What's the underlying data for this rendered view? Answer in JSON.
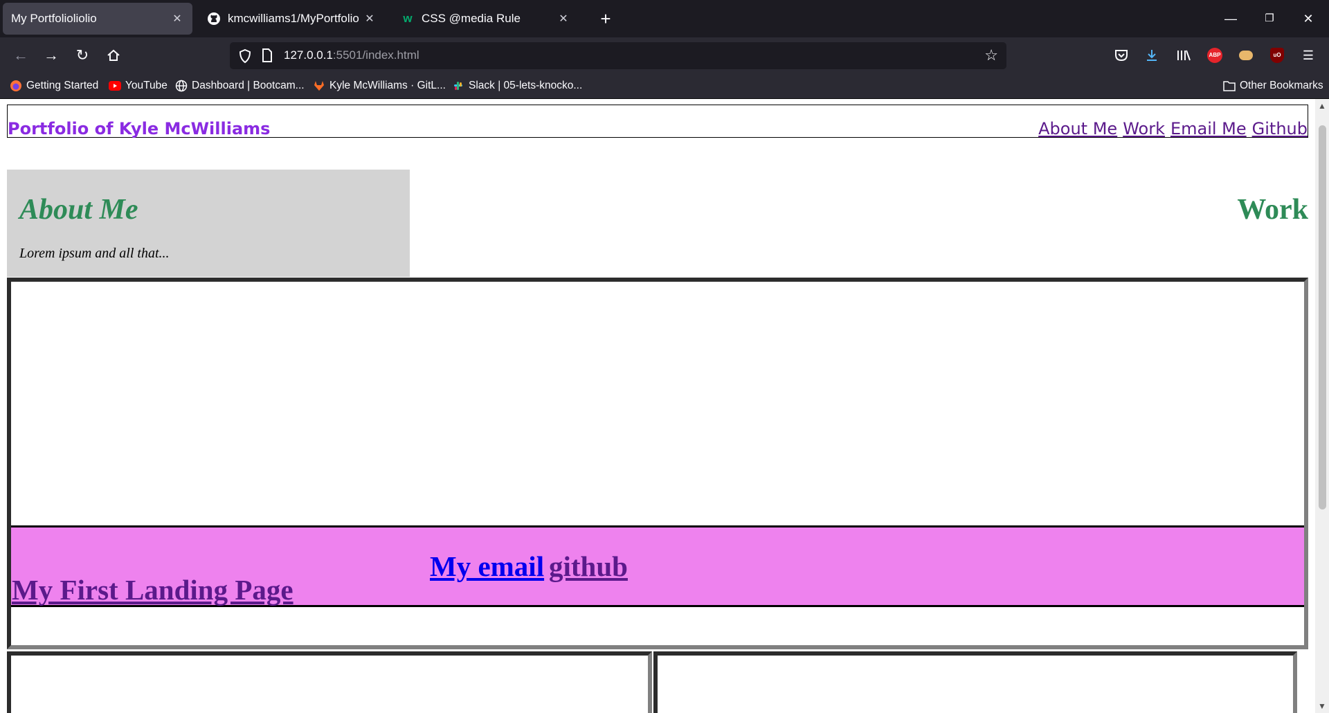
{
  "browser": {
    "tabs": [
      {
        "title": "My Portfolioliolio",
        "active": true,
        "icon": "blank-page-icon"
      },
      {
        "title": "kmcwilliams1/MyPortfolio",
        "active": false,
        "icon": "github-icon"
      },
      {
        "title": "CSS @media Rule",
        "active": false,
        "icon": "w3schools-icon"
      }
    ],
    "url": {
      "host": "127.0.0.1",
      "rest": ":5501/index.html"
    },
    "bookmarks": [
      {
        "label": "Getting Started",
        "icon": "firefox-icon"
      },
      {
        "label": "YouTube",
        "icon": "youtube-icon"
      },
      {
        "label": "Dashboard | Bootcam...",
        "icon": "globe-icon"
      },
      {
        "label": "Kyle McWilliams · GitL...",
        "icon": "gitlab-icon"
      },
      {
        "label": "Slack | 05-lets-knocko...",
        "icon": "slack-icon"
      }
    ],
    "other_bookmarks": "Other Bookmarks",
    "colors": {
      "chrome_dark": "#1c1b22",
      "toolbar": "#2b2a33",
      "active_tab": "#42414d"
    }
  },
  "page": {
    "site_title": "Portfolio of Kyle McWilliams",
    "nav": [
      "About Me",
      "Work",
      "Email Me",
      "Github"
    ],
    "about": {
      "heading": "About Me",
      "text": "Lorem ipsum and all that..."
    },
    "work": {
      "heading": "Work"
    },
    "landing": {
      "first": "My First Landing Page",
      "email": "My email",
      "github": "github"
    },
    "colors": {
      "title_purple": "#8a2be2",
      "heading_green": "#2e8b57",
      "about_bg": "#d3d3d3",
      "landing_bg": "#ee82ee",
      "link_blue": "#0000ee",
      "link_visited": "#5b1a8b"
    }
  }
}
